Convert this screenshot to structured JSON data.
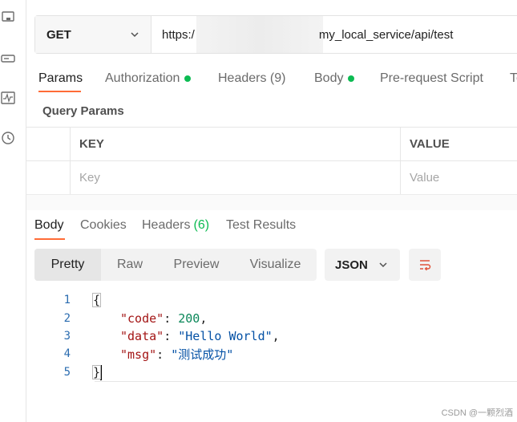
{
  "left_rail": {
    "icons": [
      "collections-icon",
      "environments-icon",
      "monitor-icon",
      "history-icon"
    ]
  },
  "request": {
    "method": "GET",
    "url_prefix": "https:/",
    "url_suffix": "my_local_service/api/test"
  },
  "request_tabs": [
    {
      "label": "Params",
      "dot": false
    },
    {
      "label": "Authorization",
      "dot": true
    },
    {
      "label": "Headers (9)",
      "dot": false
    },
    {
      "label": "Body",
      "dot": true
    },
    {
      "label": "Pre-request Script",
      "dot": false
    },
    {
      "label": "Te",
      "dot": false
    }
  ],
  "query_params": {
    "title": "Query Params",
    "headers": {
      "key": "KEY",
      "value": "VALUE"
    },
    "placeholders": {
      "key": "Key",
      "value": "Value"
    }
  },
  "response_tabs": {
    "body": "Body",
    "cookies": "Cookies",
    "headers": "Headers",
    "headers_count": "(6)",
    "test_results": "Test Results"
  },
  "view_modes": [
    "Pretty",
    "Raw",
    "Preview",
    "Visualize"
  ],
  "format": "JSON",
  "code": {
    "line_numbers": [
      "1",
      "2",
      "3",
      "4",
      "5"
    ],
    "open_brace": "{",
    "close_brace": "}",
    "entries": [
      {
        "key": "\"code\"",
        "colon": ": ",
        "value": "200",
        "comma": ",",
        "type": "num"
      },
      {
        "key": "\"data\"",
        "colon": ": ",
        "value": "\"Hello World\"",
        "comma": ",",
        "type": "str"
      },
      {
        "key": "\"msg\"",
        "colon": ": ",
        "value": "\"测试成功\"",
        "comma": "",
        "type": "str"
      }
    ]
  },
  "watermark": "CSDN @一颗烈酒",
  "colors": {
    "accent": "#ff6c37",
    "dot_green": "#0cbb52"
  }
}
